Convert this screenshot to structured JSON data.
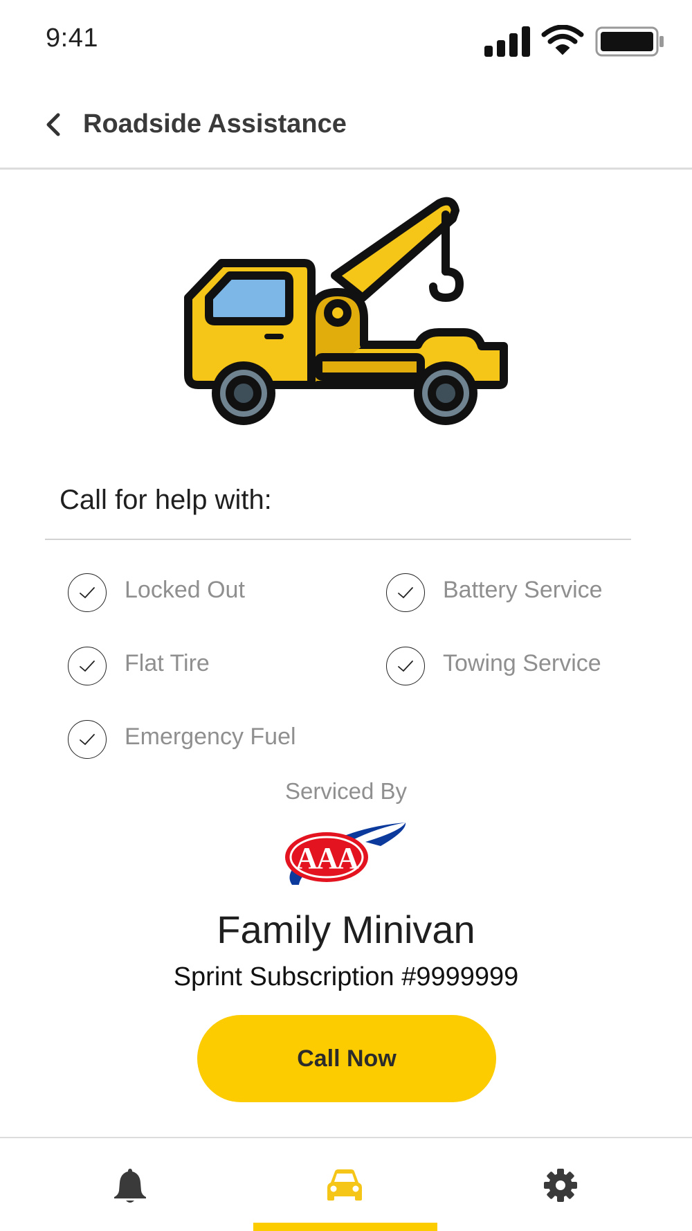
{
  "status_bar": {
    "time": "9:41",
    "icons": [
      "cellular-signal-icon",
      "wifi-icon",
      "battery-icon"
    ]
  },
  "header": {
    "back_icon": "chevron-left-icon",
    "title": "Roadside Assistance"
  },
  "illustration": {
    "icon": "tow-truck-icon"
  },
  "help": {
    "heading": "Call for help with:",
    "services": [
      {
        "label": "Locked Out"
      },
      {
        "label": "Battery Service"
      },
      {
        "label": "Flat Tire"
      },
      {
        "label": "Towing Service"
      },
      {
        "label": "Emergency Fuel"
      }
    ],
    "check_icon": "check-circle-icon"
  },
  "provider": {
    "serviced_by_label": "Serviced By",
    "logo_text": "AAA"
  },
  "vehicle": {
    "name": "Family Minivan",
    "subscription": "Sprint Subscription #9999999"
  },
  "actions": {
    "call_now_label": "Call Now"
  },
  "bottom_nav": {
    "items": [
      {
        "icon": "bell-icon",
        "active": false
      },
      {
        "icon": "car-icon",
        "active": true
      },
      {
        "icon": "gear-icon",
        "active": false
      }
    ]
  },
  "colors": {
    "accent": "#fccc00",
    "muted_text": "#8f8f8f",
    "header_text": "#3a3a3a",
    "aaa_red": "#e3141f",
    "aaa_blue": "#0b3a9c",
    "truck_yellow": "#f5c518",
    "truck_window": "#7db7e8"
  }
}
